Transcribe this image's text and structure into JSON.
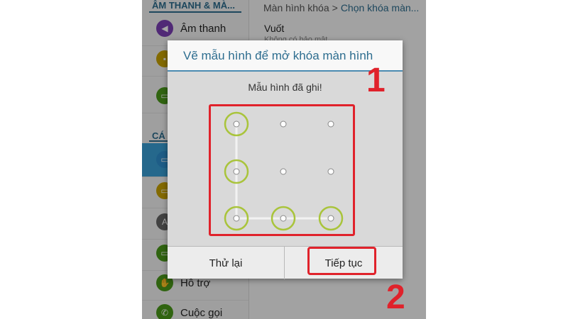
{
  "sidebar": {
    "section1_header": "ÂM THANH & MÀ...",
    "section2_header": "CÁ",
    "items": [
      {
        "label": "Âm thanh",
        "icon": "speaker-icon",
        "color": "#7b3fb5",
        "glyph": "🔊"
      },
      {
        "label": "",
        "icon": "notification-icon",
        "color": "#c9a400",
        "glyph": "■"
      },
      {
        "label": "",
        "icon": "display-icon",
        "color": "#4a9a1a",
        "glyph": "▭"
      },
      {
        "label": "",
        "icon": "lockscreen-icon",
        "color": "#2e8fd0",
        "glyph": "▭"
      },
      {
        "label": "",
        "icon": "wallpaper-icon",
        "color": "#c9a400",
        "glyph": "▭"
      },
      {
        "label": "",
        "icon": "font-icon",
        "color": "#666666",
        "glyph": "A"
      },
      {
        "label": "",
        "icon": "accessibility-icon",
        "color": "#4a9a1a",
        "glyph": "▭"
      },
      {
        "label": "Hỗ trợ",
        "icon": "help-icon",
        "color": "#4a9a1a",
        "glyph": "✋"
      },
      {
        "label": "Cuộc gọi",
        "icon": "phone-icon",
        "color": "#4a9a1a",
        "glyph": "📞"
      }
    ]
  },
  "breadcrumb": {
    "parent": "Màn hình khóa",
    "separator": ">",
    "current": "Chọn khóa màn..."
  },
  "option": {
    "title": "Vuốt",
    "subtitle": "Không có bảo mật"
  },
  "dialog": {
    "title": "Vẽ mẫu hình để mở khóa màn hình",
    "message": "Mẫu hình đã ghi!",
    "pattern": {
      "grid": "3x3",
      "selected_sequence": [
        1,
        4,
        7,
        8,
        9
      ]
    },
    "retry_button": "Thử lại",
    "next_button": "Tiếp tục"
  },
  "annotations": {
    "step1": "1",
    "step2": "2",
    "highlight_color": "#e0222b"
  }
}
